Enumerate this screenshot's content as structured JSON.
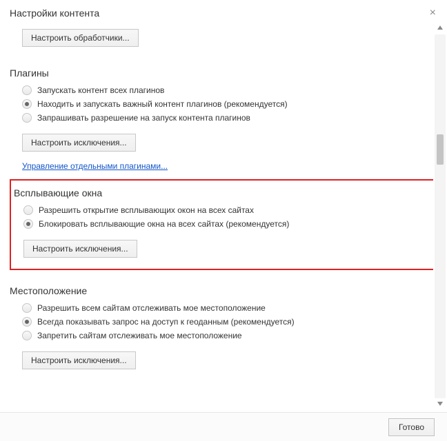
{
  "dialog": {
    "title": "Настройки контента"
  },
  "handlers": {
    "button": "Настроить обработчики..."
  },
  "plugins": {
    "title": "Плагины",
    "options": [
      {
        "label": "Запускать контент всех плагинов",
        "selected": false
      },
      {
        "label": "Находить и запускать важный контент плагинов (рекомендуется)",
        "selected": true
      },
      {
        "label": "Запрашивать разрешение на запуск контента плагинов",
        "selected": false
      }
    ],
    "exceptions_btn": "Настроить исключения...",
    "manage_link": "Управление отдельными плагинами..."
  },
  "popups": {
    "title": "Всплывающие окна",
    "options": [
      {
        "label": "Разрешить открытие всплывающих окон на всех сайтах",
        "selected": false
      },
      {
        "label": "Блокировать всплывающие окна на всех сайтах (рекомендуется)",
        "selected": true
      }
    ],
    "exceptions_btn": "Настроить исключения..."
  },
  "location": {
    "title": "Местоположение",
    "options": [
      {
        "label": "Разрешить всем сайтам отслеживать мое местоположение",
        "selected": false
      },
      {
        "label": "Всегда показывать запрос на доступ к геоданным (рекомендуется)",
        "selected": true
      },
      {
        "label": "Запретить сайтам отслеживать мое местоположение",
        "selected": false
      }
    ],
    "exceptions_btn": "Настроить исключения..."
  },
  "footer": {
    "done": "Готово"
  }
}
